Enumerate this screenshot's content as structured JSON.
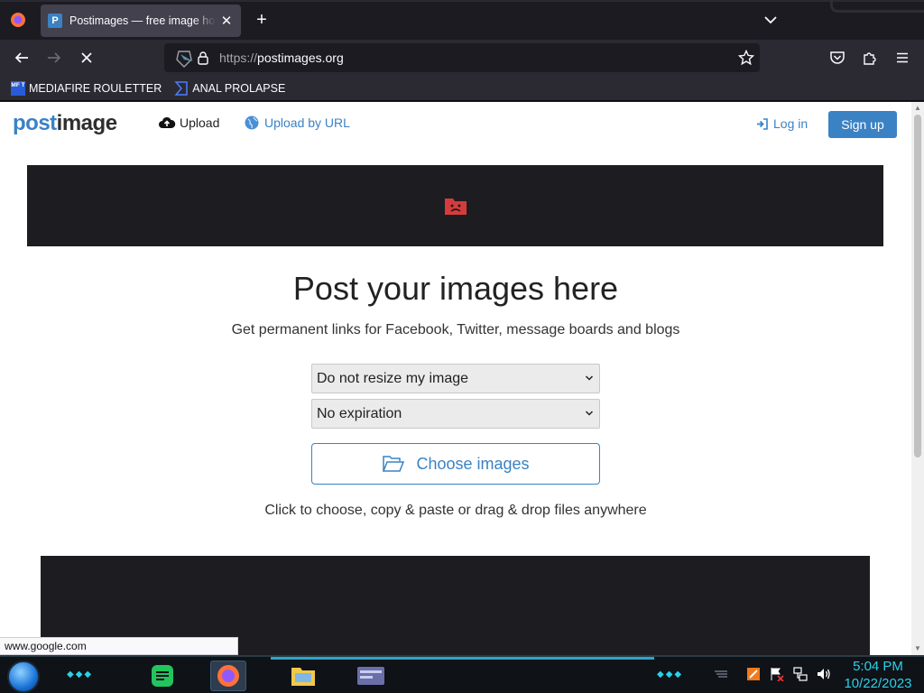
{
  "browser": {
    "tab": {
      "title": "Postimages — free image hosting",
      "favicon": "P"
    },
    "url": {
      "protocol": "https://",
      "host": "postimages.org"
    },
    "bookmarks": [
      {
        "label": "MEDIAFIRE ROULETTER",
        "icon": "MF T"
      },
      {
        "label": "ANAL PROLAPSE",
        "icon": "sigma-icon"
      }
    ],
    "status_link": "www.google.com"
  },
  "site": {
    "logo": {
      "part1": "post",
      "part2": "image"
    },
    "nav": {
      "upload": "Upload",
      "upload_by_url": "Upload by URL",
      "login": "Log in",
      "signup": "Sign up"
    },
    "hero": {
      "title": "Post your images here",
      "subtitle": "Get permanent links for Facebook, Twitter, message boards and blogs"
    },
    "resize_select": {
      "value": "Do not resize my image"
    },
    "expire_select": {
      "value": "No expiration"
    },
    "choose_button": "Choose images",
    "hint": "Click to choose, copy & paste or drag & drop files anywhere"
  },
  "taskbar": {
    "clock": {
      "time": "5:04 PM",
      "date": "10/22/2023"
    }
  },
  "colors": {
    "brand_blue": "#3b82c4",
    "ad_bg": "#1d1c21",
    "clock_cyan": "#2ad1e8"
  }
}
